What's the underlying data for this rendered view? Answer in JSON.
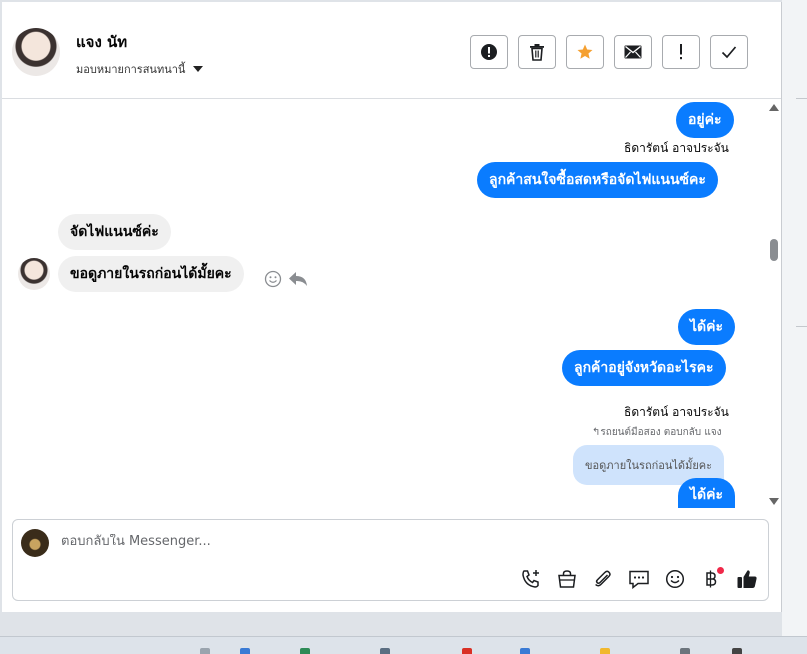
{
  "colors": {
    "accent_blue": "#0a7cff",
    "quoted_bg": "#cfe3fc",
    "incoming_bg": "#f0f0f0",
    "star_orange": "#f5a030",
    "notify_red": "#f02849"
  },
  "header": {
    "contact_name": "แจง นัท",
    "assign_label": "มอบหมายการสนทนานี้",
    "toolbar": {
      "spam": "alert-circle-icon",
      "delete": "trash-icon",
      "follow_up": "star-icon",
      "mark_unread": "envelope-icon",
      "important": "exclamation-icon",
      "done": "checkmark-icon"
    }
  },
  "messages": [
    {
      "dir": "out",
      "text": "อยู่ค่ะ"
    },
    {
      "dir": "sender",
      "text": "ธิดารัตน์ อาจประจัน"
    },
    {
      "dir": "out",
      "text": "ลูกค้าสนใจซื้อสดหรือจัดไฟแนนซ์คะ"
    },
    {
      "dir": "in",
      "text": "จัดไฟแนนซ์ค่ะ"
    },
    {
      "dir": "in",
      "text": "ขอดูภายในรถก่อนได้มั้ยคะ"
    },
    {
      "dir": "out",
      "text": "ได้ค่ะ"
    },
    {
      "dir": "out",
      "text": "ลูกค้าอยู่จังหวัดอะไรคะ"
    },
    {
      "dir": "sender",
      "text": "ธิดารัตน์ อาจประจัน"
    },
    {
      "dir": "reply_note",
      "text": "รถยนต์มือสอง ตอบกลับ แจง"
    },
    {
      "dir": "quoted",
      "text": "ขอดูภายในรถก่อนได้มั้ยคะ"
    },
    {
      "dir": "out",
      "text": "ได้ค่ะ"
    }
  ],
  "composer": {
    "placeholder": "ตอบกลับใน Messenger...",
    "value": "",
    "icons": [
      "call-add-icon",
      "shopping-bag-icon",
      "paperclip-icon",
      "comment-icon",
      "emoji-icon",
      "baht-payment-icon",
      "thumbs-up-icon"
    ]
  }
}
